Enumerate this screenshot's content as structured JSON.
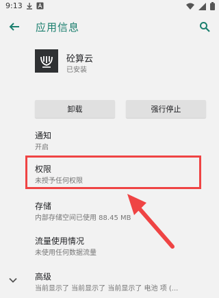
{
  "status_bar": {
    "time": "9:13"
  },
  "app_bar": {
    "title": "应用信息"
  },
  "app": {
    "name": "砼算云",
    "status": "已安装"
  },
  "buttons": {
    "uninstall": "卸载",
    "force_stop": "强行停止"
  },
  "settings": [
    {
      "title": "通知",
      "subtitle": "开启"
    },
    {
      "title": "权限",
      "subtitle": "未授予任何权限"
    },
    {
      "title": "存储",
      "subtitle": "内部存储空间已使用 88.45 MB"
    },
    {
      "title": "流量使用情况",
      "subtitle": "未使用任何数据流量"
    },
    {
      "title": "高级",
      "subtitle": "当前显示了 当前显示了 当前显示了 电池 项 (..."
    }
  ],
  "colors": {
    "accent": "#1b7f6e",
    "highlight": "#ef4444",
    "button_bg": "#e0e0e0"
  },
  "icons": [
    "back-arrow-icon",
    "search-icon",
    "chevron-down-icon",
    "wifi-icon",
    "signal-icon",
    "battery-icon",
    "download-icon",
    "app-logo-icon"
  ]
}
